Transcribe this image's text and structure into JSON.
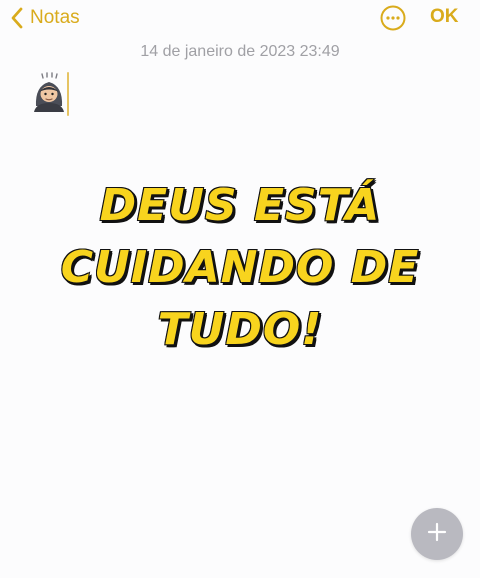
{
  "nav": {
    "back_label": "Notas",
    "done_label": "OK"
  },
  "note": {
    "date": "14 de janeiro de 2023 23:49",
    "emoji": "hooded-person-emoji",
    "headline_lines": [
      "DEUS ESTÁ",
      "CUIDANDO DE",
      "TUDO!"
    ]
  },
  "colors": {
    "accent": "#d9ab1c",
    "headline_fill": "#f8d41e",
    "headline_outline": "#111111",
    "date_text": "#a0a0a5",
    "fab_bg": "#b9b9c0"
  },
  "icons": {
    "back": "chevron-left-icon",
    "more": "ellipsis-circle-icon",
    "add": "plus-icon"
  }
}
